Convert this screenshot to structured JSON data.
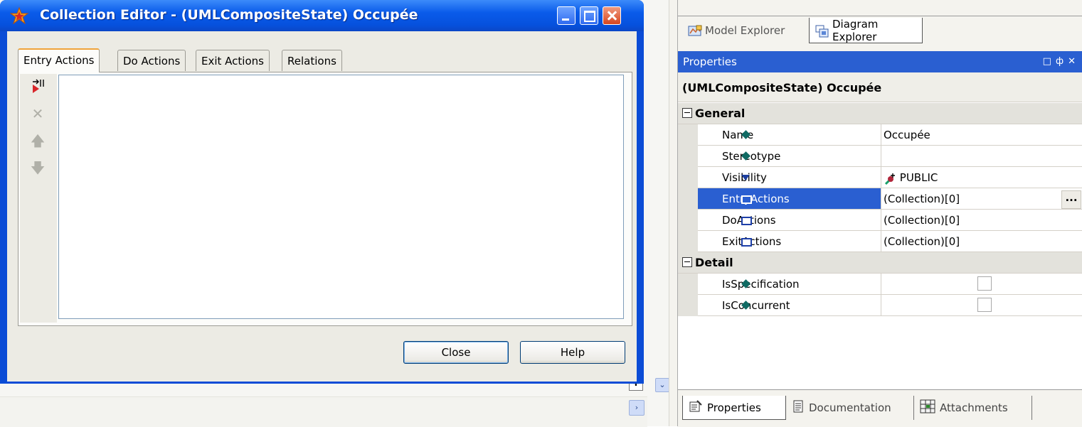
{
  "dialog": {
    "title": "Collection Editor - (UMLCompositeState) Occupée",
    "tabs": [
      {
        "label": "Entry Actions",
        "active": true
      },
      {
        "label": "Do Actions",
        "active": false
      },
      {
        "label": "Exit Actions",
        "active": false
      },
      {
        "label": "Relations",
        "active": false
      }
    ],
    "toolbar_icons": [
      "add-action-icon",
      "delete-icon",
      "move-up-icon",
      "move-down-icon"
    ],
    "close_label": "Close",
    "help_label": "Help"
  },
  "explorer": {
    "tabs": [
      {
        "label": "Model Explorer",
        "active": false
      },
      {
        "label": "Diagram Explorer",
        "active": true
      }
    ]
  },
  "properties": {
    "panel_title": "Properties",
    "object_title": "(UMLCompositeState) Occupée",
    "categories": [
      {
        "label": "General",
        "rows": [
          {
            "name": "Name",
            "value": "Occupée",
            "marker": "diamond"
          },
          {
            "name": "Stereotype",
            "value": "",
            "marker": "diamond"
          },
          {
            "name": "Visibility",
            "value": "PUBLIC",
            "marker": "triangle"
          },
          {
            "name": "EntryActions",
            "value": "(Collection)[0]",
            "marker": "box",
            "selected": true,
            "ellipsis": "..."
          },
          {
            "name": "DoActions",
            "value": "(Collection)[0]",
            "marker": "box"
          },
          {
            "name": "ExitActions",
            "value": "(Collection)[0]",
            "marker": "box"
          }
        ]
      },
      {
        "label": "Detail",
        "rows": [
          {
            "name": "IsSpecification",
            "checked": false,
            "marker": "diamond"
          },
          {
            "name": "IsConcurrent",
            "checked": false,
            "marker": "diamond"
          }
        ]
      }
    ]
  },
  "bottom_tabs": [
    {
      "label": "Properties",
      "active": true
    },
    {
      "label": "Documentation",
      "active": false
    },
    {
      "label": "Attachments",
      "active": false
    }
  ],
  "colors": {
    "selection": "#2a5fd1",
    "titlebar": "#0651dd",
    "close_button": "#d8461f"
  }
}
